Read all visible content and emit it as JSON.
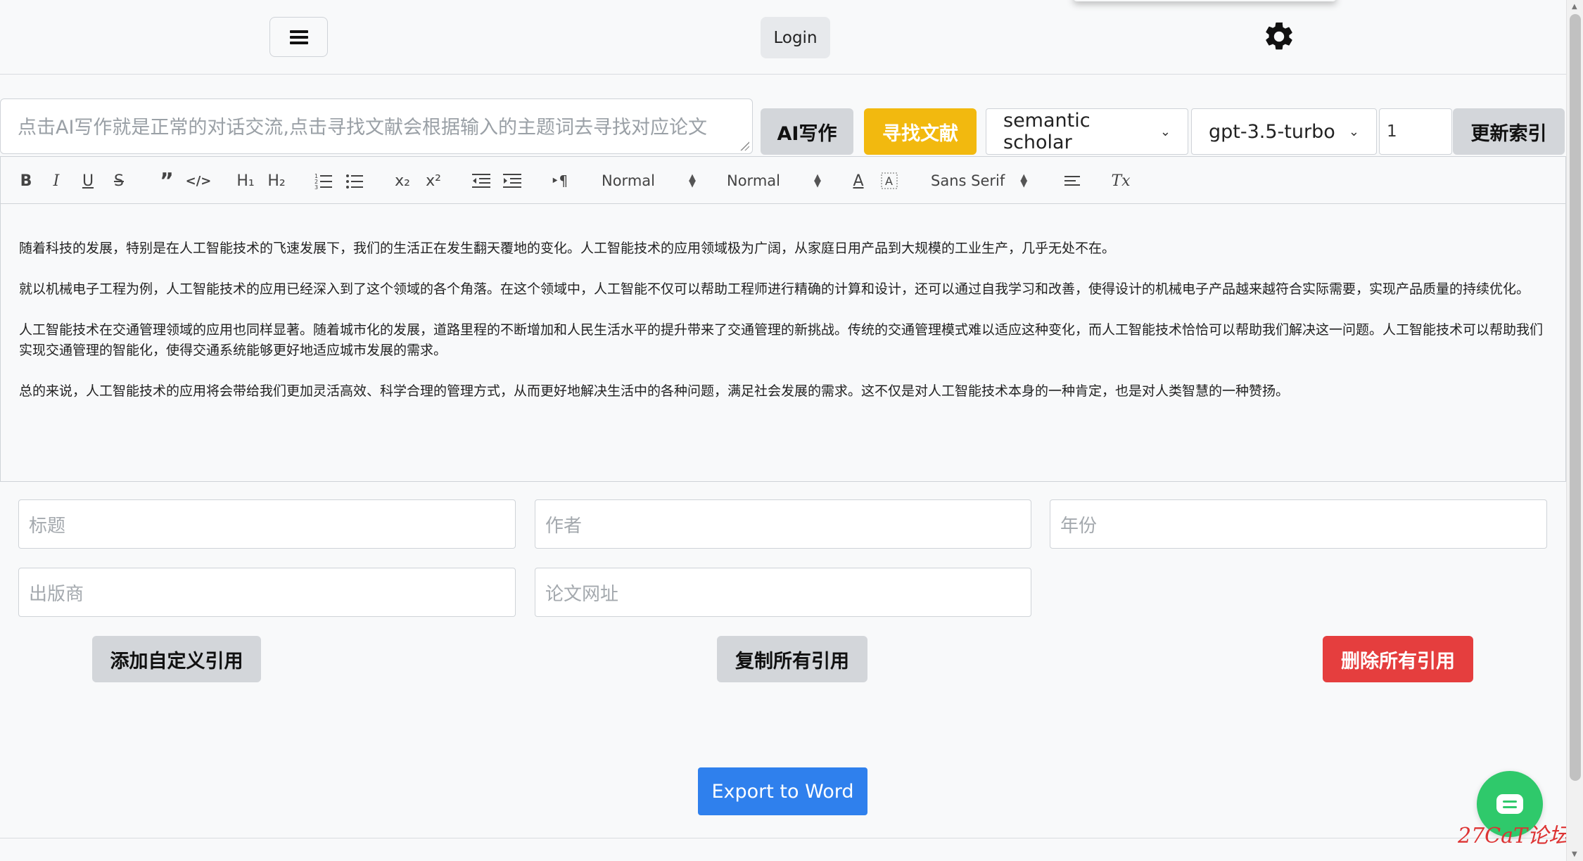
{
  "header": {
    "login_label": "Login"
  },
  "prompt": {
    "placeholder": "点击AI写作就是正常的对话交流,点击寻找文献会根据输入的主题词去寻找对应论文",
    "ai_write_label": "AI写作",
    "find_refs_label": "寻找文献",
    "source_selected": "semantic scholar",
    "model_selected": "gpt-3.5-turbo",
    "count_value": "1",
    "update_index_label": "更新索引"
  },
  "toolbar": {
    "header_select": "Normal",
    "size_select": "Normal",
    "font_select": "Sans Serif",
    "bold": "B",
    "italic": "I",
    "underline": "U",
    "strike": "S",
    "h1": "H₁",
    "h2": "H₂",
    "sub": "x₂",
    "sup": "x²",
    "text_color": "A",
    "clear_format": "Tx"
  },
  "editor": {
    "paragraphs": [
      "随着科技的发展，特别是在人工智能技术的飞速发展下，我们的生活正在发生翻天覆地的变化。人工智能技术的应用领域极为广阔，从家庭日用产品到大规模的工业生产，几乎无处不在。",
      "就以机械电子工程为例，人工智能技术的应用已经深入到了这个领域的各个角落。在这个领域中，人工智能不仅可以帮助工程师进行精确的计算和设计，还可以通过自我学习和改善，使得设计的机械电子产品越来越符合实际需要，实现产品质量的持续优化。",
      "人工智能技术在交通管理领域的应用也同样显著。随着城市化的发展，道路里程的不断增加和人民生活水平的提升带来了交通管理的新挑战。传统的交通管理模式难以适应这种变化，而人工智能技术恰恰可以帮助我们解决这一问题。人工智能技术可以帮助我们实现交通管理的智能化，使得交通系统能够更好地适应城市发展的需求。",
      "总的来说，人工智能技术的应用将会带给我们更加灵活高效、科学合理的管理方式，从而更好地解决生活中的各种问题，满足社会发展的需求。这不仅是对人工智能技术本身的一种肯定，也是对人类智慧的一种赞扬。"
    ]
  },
  "citation": {
    "title_placeholder": "标题",
    "author_placeholder": "作者",
    "year_placeholder": "年份",
    "publisher_placeholder": "出版商",
    "url_placeholder": "论文网址",
    "add_label": "添加自定义引用",
    "copy_label": "复制所有引用",
    "delete_label": "删除所有引用"
  },
  "export_label": "Export to Word",
  "watermark": "27CaT论坛",
  "colors": {
    "find_btn": "#f2b90f",
    "delete_btn": "#e53e3e",
    "export_btn": "#2f80ed",
    "chat_btn": "#2fc96b"
  }
}
